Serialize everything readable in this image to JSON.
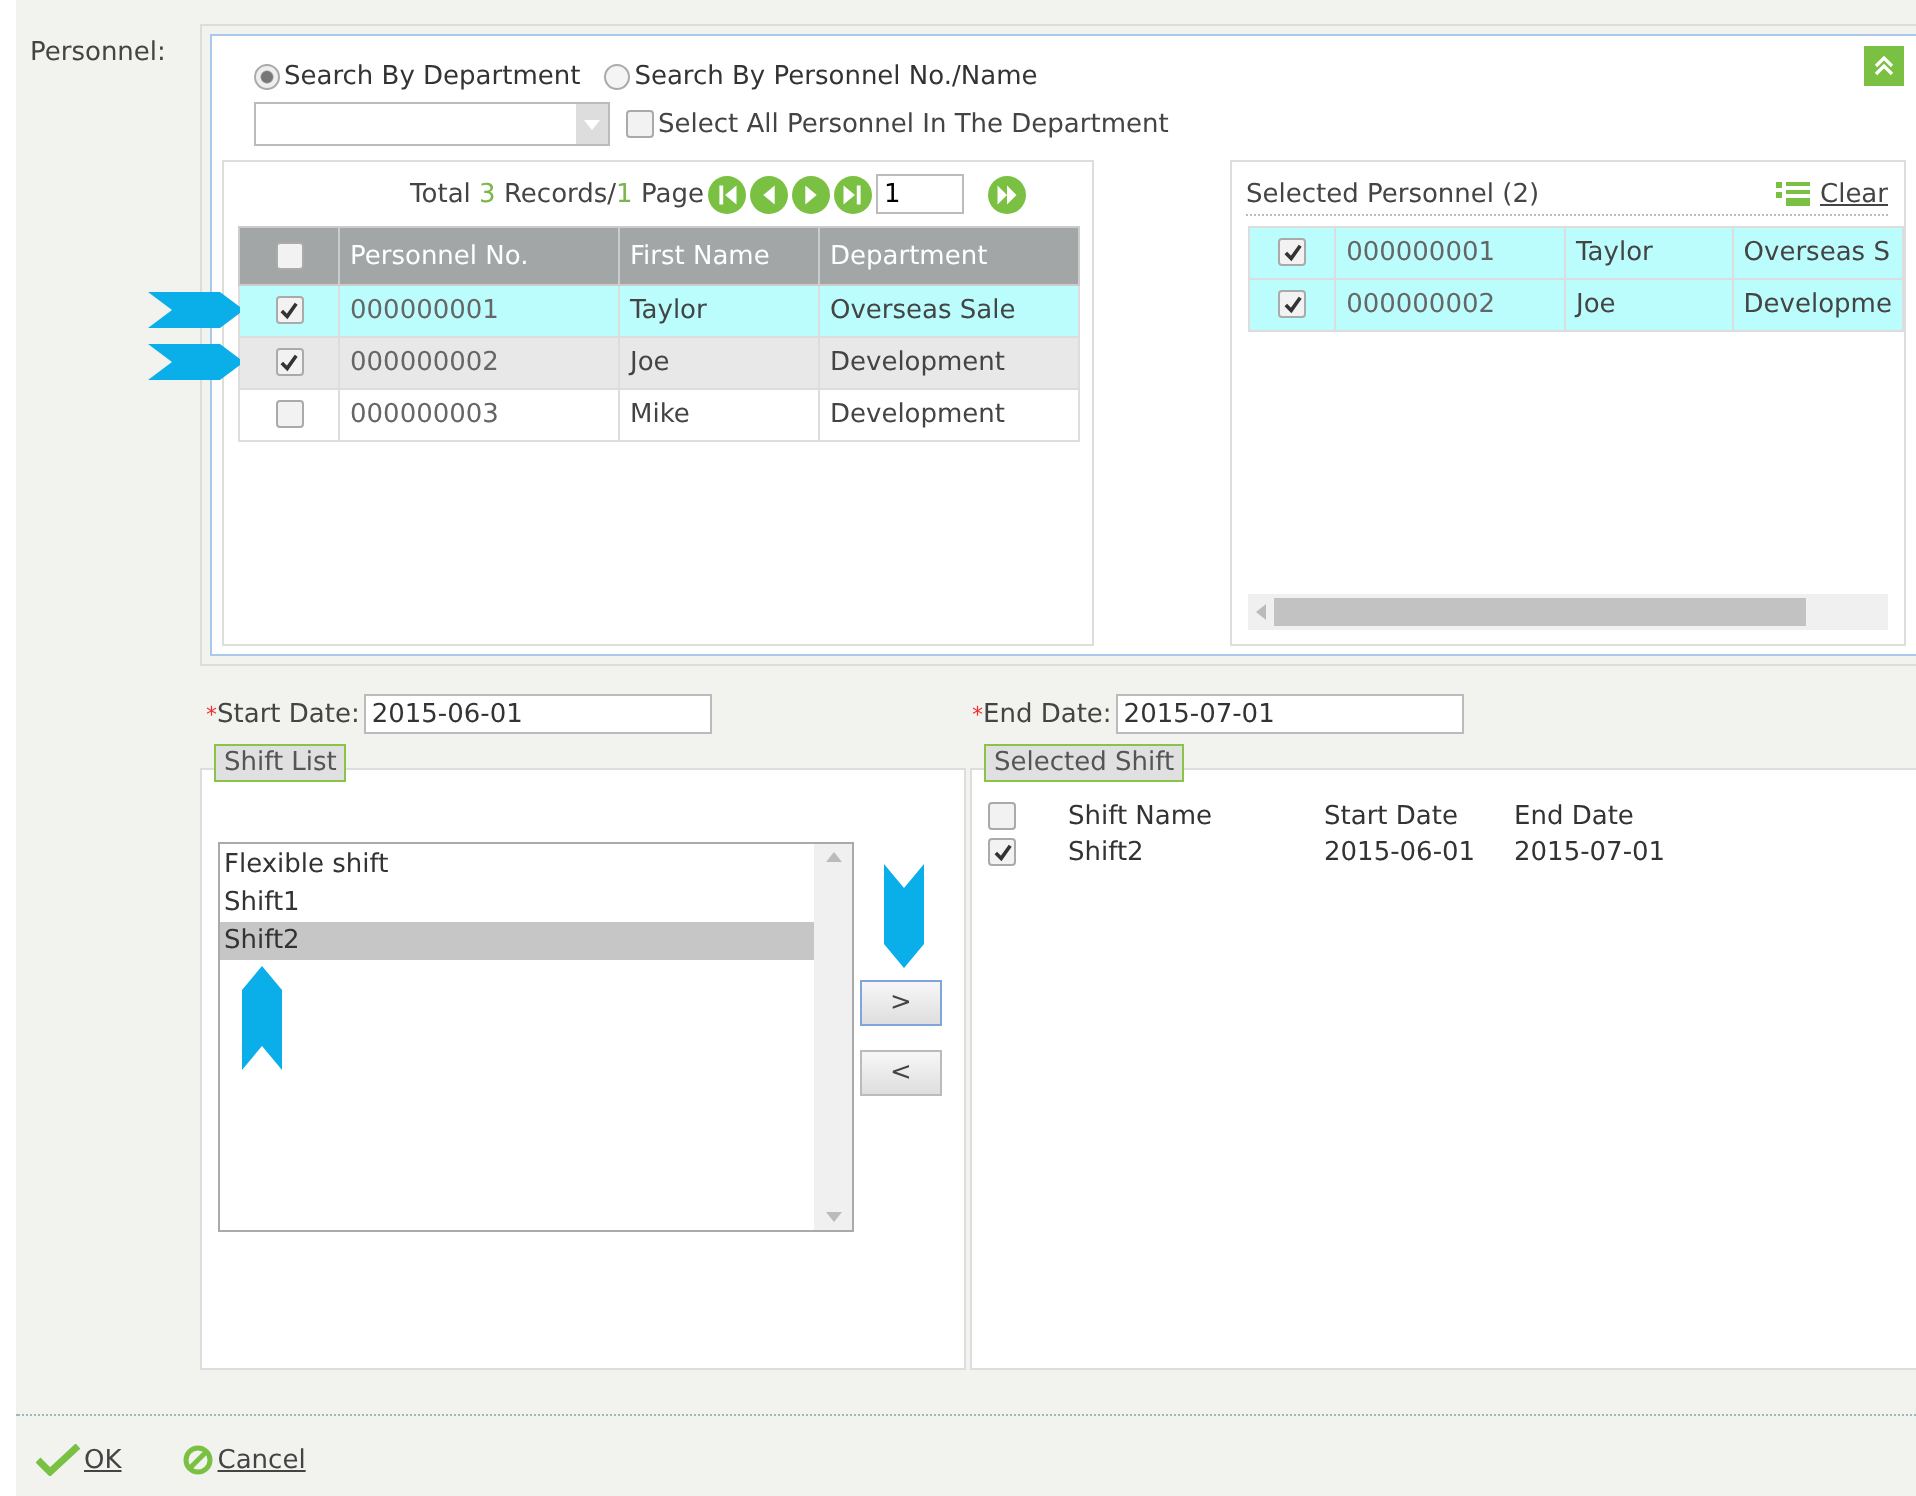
{
  "personnel_label": "Personnel:",
  "search_modes": [
    {
      "label": "Search By Department",
      "selected": true
    },
    {
      "label": "Search By Personnel No./Name",
      "selected": false
    }
  ],
  "select_all": {
    "label": "Select All Personnel In The Department",
    "checked": false
  },
  "pager": {
    "total_prefix": "Total",
    "total": "3",
    "records_label": "Records/",
    "pages": "1",
    "page_label": "Page",
    "page_input": "1"
  },
  "personnel_table": {
    "columns": [
      "Personnel No.",
      "First Name",
      "Department"
    ],
    "header_checked": false,
    "rows": [
      {
        "cells": [
          "000000001",
          "Taylor",
          "Overseas Sale"
        ],
        "checked": true,
        "selected": true,
        "hovered": false,
        "pointer": true
      },
      {
        "cells": [
          "000000002",
          "Joe",
          "Development"
        ],
        "checked": true,
        "selected": false,
        "hovered": true,
        "pointer": true
      },
      {
        "cells": [
          "000000003",
          "Mike",
          "Development"
        ],
        "checked": false,
        "selected": false,
        "hovered": false,
        "pointer": false
      }
    ]
  },
  "selected_personnel": {
    "title": "Selected Personnel (2)",
    "clear": "Clear",
    "rows": [
      {
        "cells": [
          "000000001",
          "Taylor",
          "Overseas S"
        ],
        "checked": true
      },
      {
        "cells": [
          "000000002",
          "Joe",
          "Developme"
        ],
        "checked": true
      }
    ]
  },
  "start_date": {
    "required_mark": "*",
    "label": "Start Date:",
    "value": "2015-06-01"
  },
  "end_date": {
    "required_mark": "*",
    "label": "End Date:",
    "value": "2015-07-01"
  },
  "shift_list": {
    "legend": "Shift List",
    "pointer": true,
    "items": [
      {
        "label": "Flexible shift",
        "selected": false
      },
      {
        "label": "Shift1",
        "selected": false
      },
      {
        "label": "Shift2",
        "selected": true
      }
    ]
  },
  "transfer_buttons": [
    {
      "label": ">",
      "pointer": true
    },
    {
      "label": "<",
      "pointer": false
    }
  ],
  "selected_shift": {
    "legend": "Selected Shift",
    "columns": [
      "Shift Name",
      "Start Date",
      "End Date"
    ],
    "header_checked": false,
    "rows": [
      {
        "cells": [
          "Shift2",
          "2015-06-01",
          "2015-07-01"
        ],
        "checked": true
      }
    ]
  },
  "footer": {
    "ok": "OK",
    "cancel": "Cancel"
  }
}
